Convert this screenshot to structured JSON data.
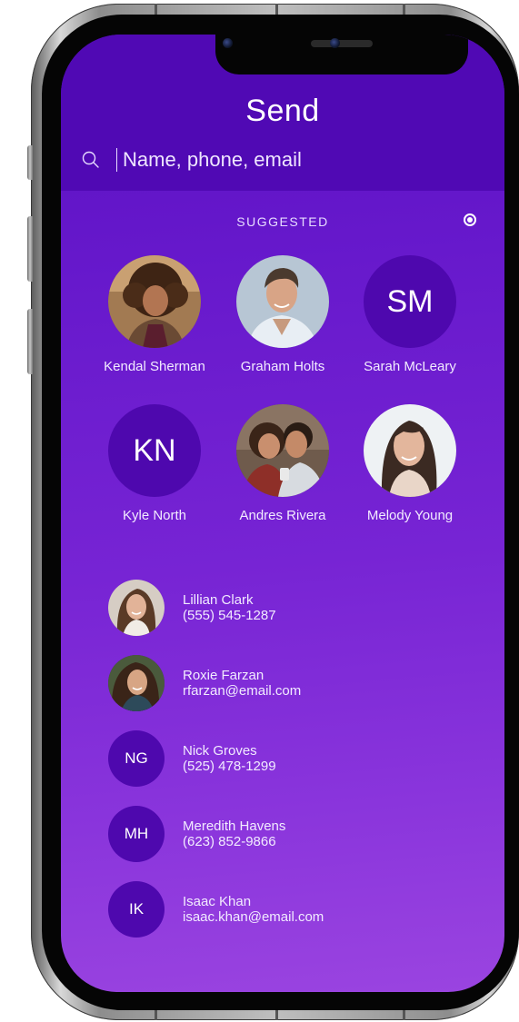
{
  "header": {
    "title": "Send",
    "search_placeholder": "Name, phone, email"
  },
  "suggested": {
    "label": "SUGGESTED",
    "contacts": [
      {
        "name": "Kendal Sherman",
        "initials": "",
        "type": "photo"
      },
      {
        "name": "Graham Holts",
        "initials": "",
        "type": "photo"
      },
      {
        "name": "Sarah McLeary",
        "initials": "SM",
        "type": "initials"
      },
      {
        "name": "Kyle North",
        "initials": "KN",
        "type": "initials"
      },
      {
        "name": "Andres Rivera",
        "initials": "",
        "type": "photo"
      },
      {
        "name": "Melody Young",
        "initials": "",
        "type": "photo"
      }
    ]
  },
  "contacts": [
    {
      "name": "Lillian Clark",
      "detail": "(555) 545-1287",
      "initials": "",
      "type": "photo"
    },
    {
      "name": "Roxie Farzan",
      "detail": "rfarzan@email.com",
      "initials": "",
      "type": "photo"
    },
    {
      "name": "Nick Groves",
      "detail": "(525) 478-1299",
      "initials": "NG",
      "type": "initials"
    },
    {
      "name": "Meredith Havens",
      "detail": "(623) 852-9866",
      "initials": "MH",
      "type": "initials"
    },
    {
      "name": "Isaac Khan",
      "detail": "isaac.khan@email.com",
      "initials": "IK",
      "type": "initials"
    }
  ],
  "colors": {
    "header_bg": "#5009b4",
    "avatar_bg": "#4e08ae",
    "gradient_top": "#5a0fc2",
    "gradient_bottom": "#9a44e0"
  },
  "icons": [
    "search-icon",
    "radio-selected-icon"
  ]
}
